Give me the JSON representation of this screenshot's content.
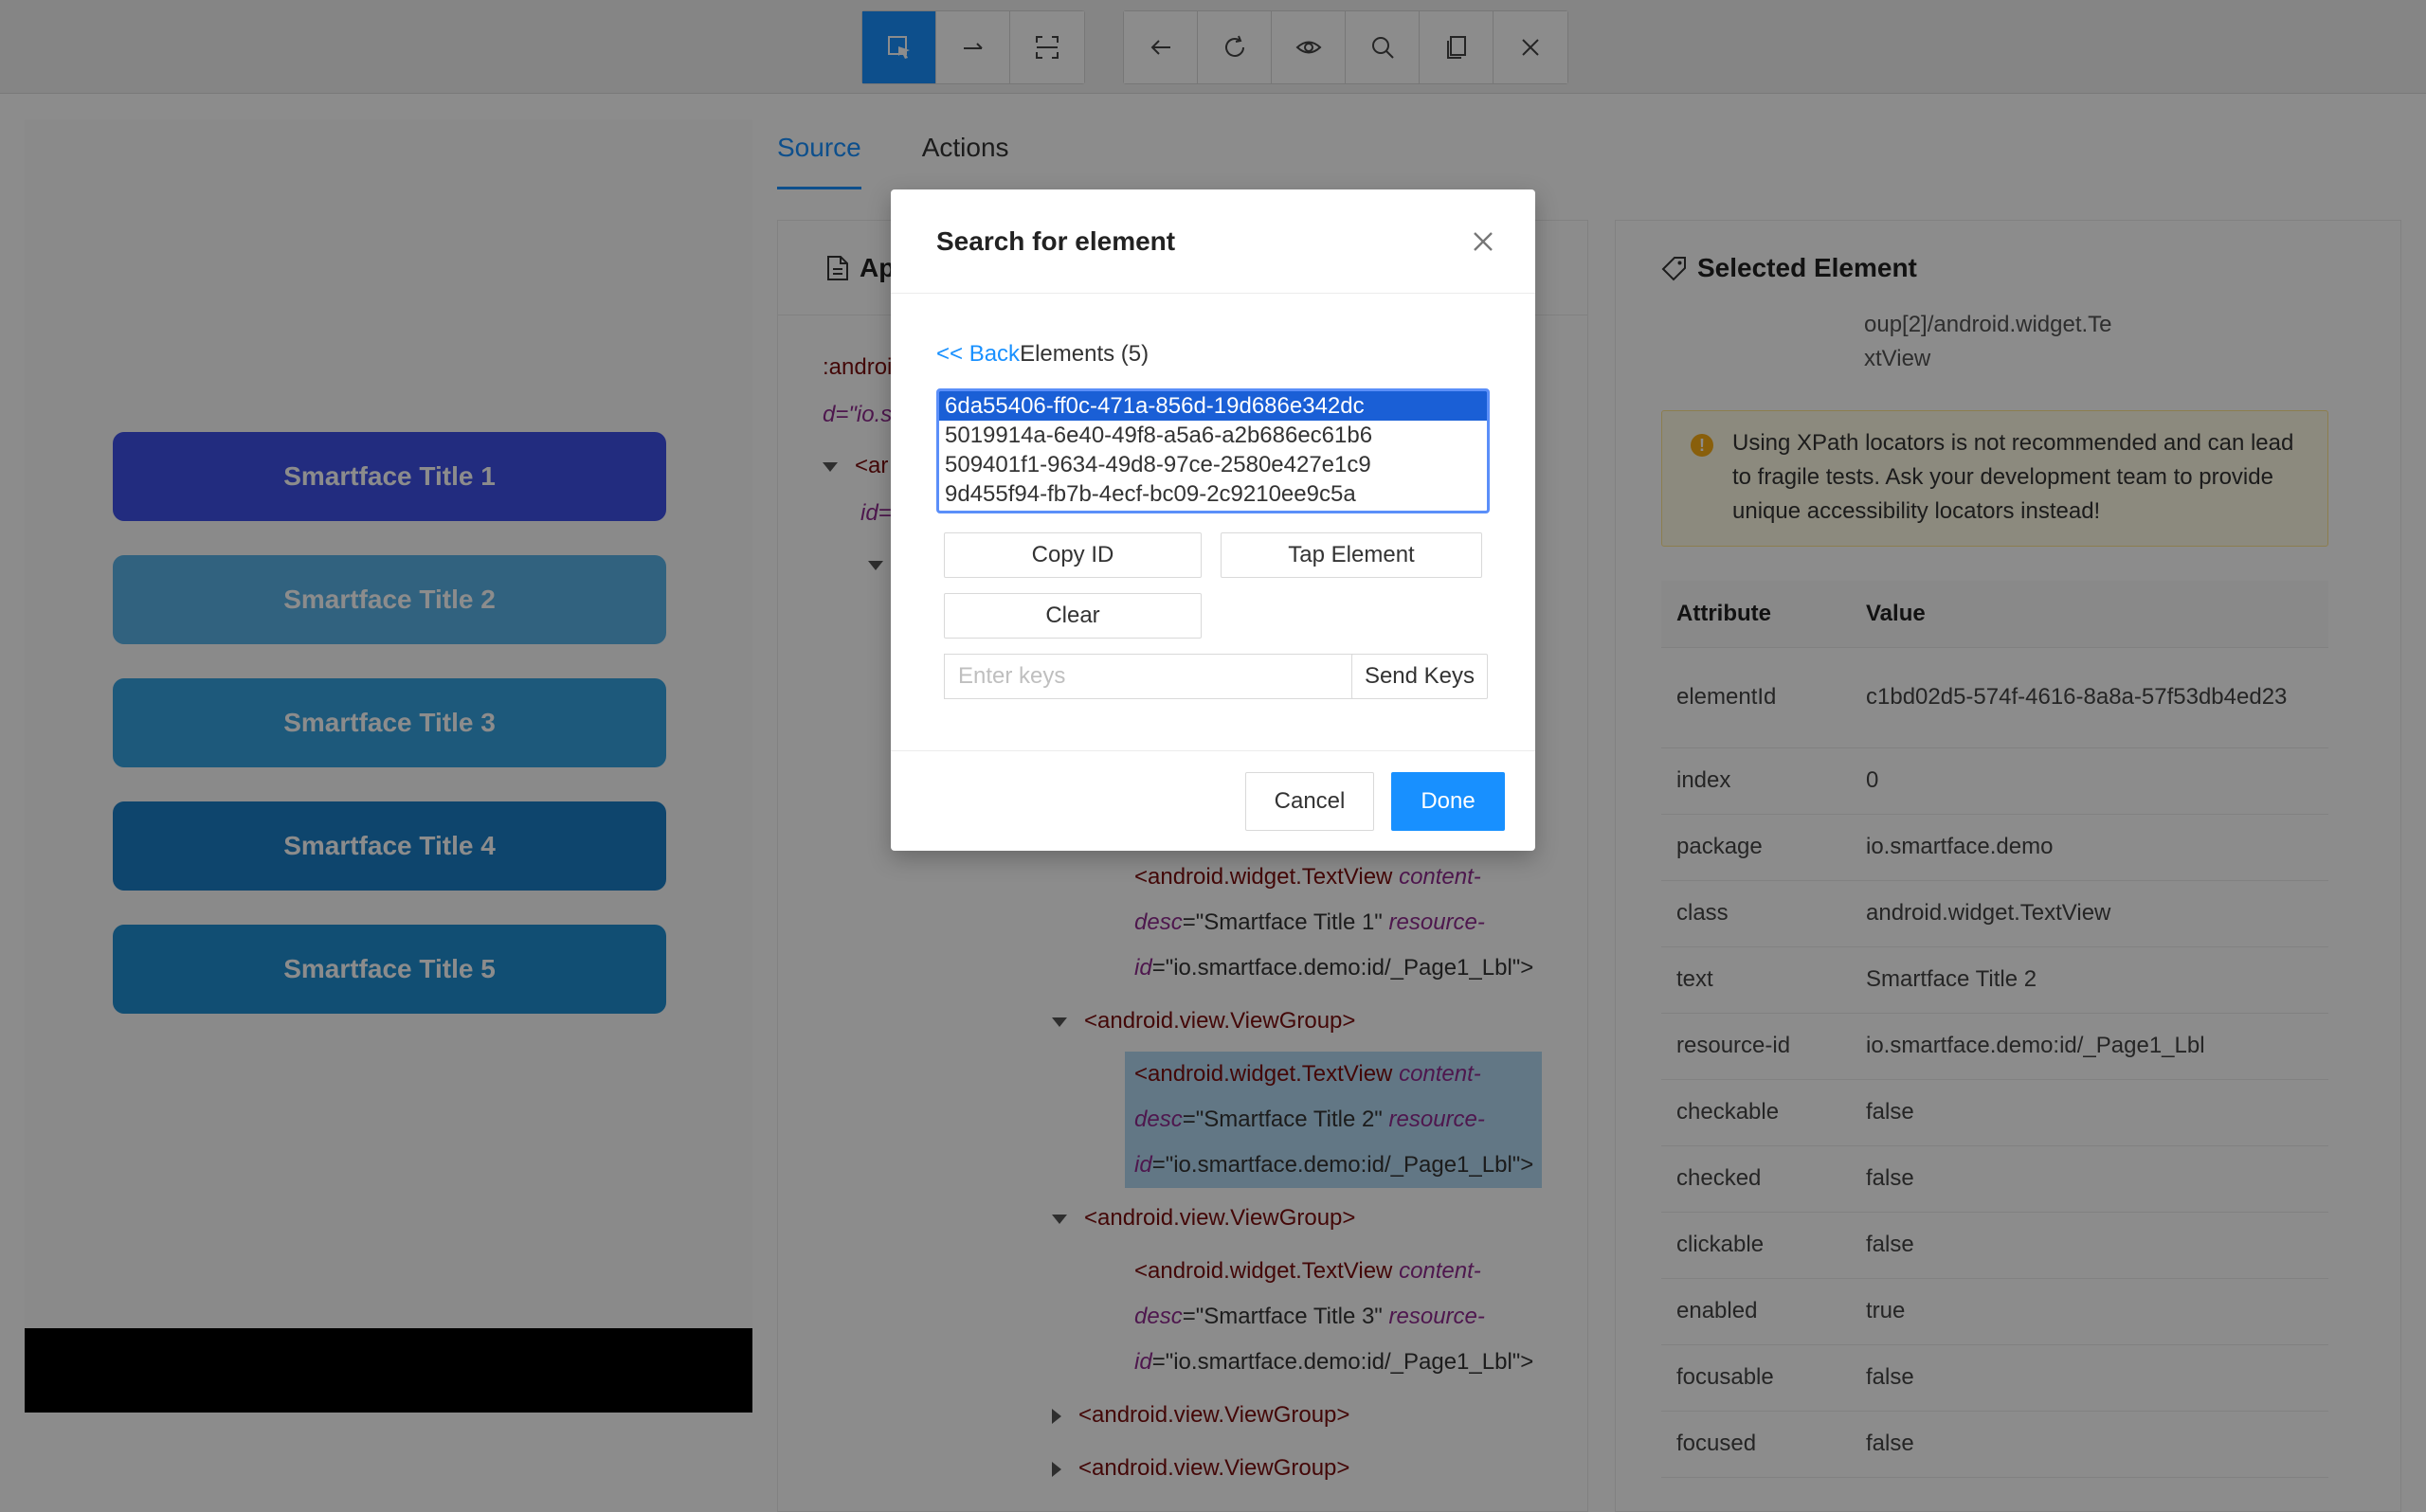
{
  "toolbar": {
    "left_group": [
      {
        "name": "select-element-icon",
        "active": true
      },
      {
        "name": "swipe-arrow-icon",
        "active": false
      },
      {
        "name": "screenshot-frame-icon",
        "active": false
      }
    ],
    "right_group": [
      {
        "name": "back-arrow-icon"
      },
      {
        "name": "refresh-icon"
      },
      {
        "name": "eye-icon"
      },
      {
        "name": "search-icon"
      },
      {
        "name": "copy-icon"
      },
      {
        "name": "close-icon"
      }
    ]
  },
  "device": {
    "buttons": [
      {
        "label": "Smartface Title 1",
        "color": "#3f51e8"
      },
      {
        "label": "Smartface Title 2",
        "color": "#5ab3e8"
      },
      {
        "label": "Smartface Title 3",
        "color": "#36a3e0"
      },
      {
        "label": "Smartface Title 4",
        "color": "#1b7ec7"
      },
      {
        "label": "Smartface Title 5",
        "color": "#1f8ed2"
      }
    ]
  },
  "tabs": {
    "source": "Source",
    "actions": "Actions"
  },
  "source": {
    "header": "App Source",
    "frag_android": ":androi",
    "frag_id": "d=\"io.s",
    "frag_open": "<ar",
    "frag_id2": "id=",
    "line1_tag": "<android.widget.TextView",
    "line1_attr": "content-",
    "line2_attr": "desc",
    "line2_val": "=\"Smartface Title 1\"",
    "line2_attr2": "resource-",
    "line3_attr": "id",
    "line3_val": "=\"io.smartface.demo:id/_Page1_Lbl\">",
    "vg1": "<android.view.ViewGroup>",
    "t2_tag": "<android.widget.TextView",
    "t2_attr": "content-",
    "t2_desc": "desc",
    "t2_val": "=\"Smartface Title 2\"",
    "t2_res": "resource-",
    "t2_id": "id",
    "t2_idval": "=\"io.smartface.demo:id/_Page1_Lbl\">",
    "vg2": "<android.view.ViewGroup>",
    "t3_tag": "<android.widget.TextView",
    "t3_attr": "content-",
    "t3_desc": "desc",
    "t3_val": "=\"Smartface Title 3\"",
    "t3_res": "resource-",
    "t3_id": "id",
    "t3_idval": "=\"io.smartface.demo:id/_Page1_Lbl\">",
    "vg3": "<android.view.ViewGroup>",
    "vg4": "<android.view.ViewGroup>"
  },
  "selected": {
    "header": "Selected Element",
    "xpath_tail_1": "oup[2]/android.widget.Te",
    "xpath_tail_2": "xtView",
    "warning": "Using XPath locators is not recommended and can lead to fragile tests. Ask your development team to provide unique accessibility locators instead!",
    "col_attr": "Attribute",
    "col_value": "Value",
    "rows": [
      {
        "k": "elementId",
        "v": "c1bd02d5-574f-4616-8a8a-57f53db4ed23"
      },
      {
        "k": "index",
        "v": "0"
      },
      {
        "k": "package",
        "v": "io.smartface.demo"
      },
      {
        "k": "class",
        "v": "android.widget.TextView"
      },
      {
        "k": "text",
        "v": "Smartface Title 2"
      },
      {
        "k": "resource-id",
        "v": "io.smartface.demo:id/_Page1_Lbl"
      },
      {
        "k": "checkable",
        "v": "false"
      },
      {
        "k": "checked",
        "v": "false"
      },
      {
        "k": "clickable",
        "v": "false"
      },
      {
        "k": "enabled",
        "v": "true"
      },
      {
        "k": "focusable",
        "v": "false"
      },
      {
        "k": "focused",
        "v": "false"
      }
    ]
  },
  "modal": {
    "title": "Search for element",
    "back_link": "<< Back",
    "elements_label": "Elements (5)",
    "ids": [
      "6da55406-ff0c-471a-856d-19d686e342dc",
      "5019914a-6e40-49f8-a5a6-a2b686ec61b6",
      "509401f1-9634-49d8-97ce-2580e427e1c9",
      "9d455f94-fb7b-4ecf-bc09-2c9210ee9c5a"
    ],
    "copy_id": "Copy ID",
    "tap_element": "Tap Element",
    "clear": "Clear",
    "keys_placeholder": "Enter keys",
    "send_keys": "Send Keys",
    "cancel": "Cancel",
    "done": "Done"
  }
}
